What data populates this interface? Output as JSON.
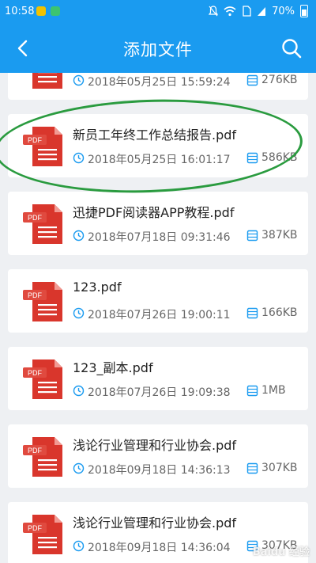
{
  "status_bar": {
    "time": "10:58",
    "battery_percent": "70%",
    "icons": [
      "notifications-off-icon",
      "wifi-icon",
      "sim-icon",
      "signal-icon",
      "battery-icon"
    ]
  },
  "toolbar": {
    "title": "添加文件",
    "back_icon": "chevron-left-icon",
    "search_icon": "search-icon"
  },
  "files": [
    {
      "name": "",
      "date": "2018年05月25日 15:59:24",
      "size": "276KB"
    },
    {
      "name": "新员工年终工作总结报告.pdf",
      "date": "2018年05月25日 16:01:17",
      "size": "586KB"
    },
    {
      "name": "迅捷PDF阅读器APP教程.pdf",
      "date": "2018年07月18日 09:31:46",
      "size": "387KB"
    },
    {
      "name": "123.pdf",
      "date": "2018年07月26日 19:00:11",
      "size": "166KB"
    },
    {
      "name": "123_副本.pdf",
      "date": "2018年07月26日 19:09:38",
      "size": "1MB"
    },
    {
      "name": "浅论行业管理和行业协会.pdf",
      "date": "2018年09月18日 14:36:13",
      "size": "307KB"
    },
    {
      "name": "浅论行业管理和行业协会.pdf",
      "date": "2018年09月18日 14:36:04",
      "size": "307KB"
    }
  ],
  "pdf_icon_label": "PDF",
  "watermark": "Baidu 经验",
  "colors": {
    "primary": "#1a9bf0",
    "pdf_red": "#d9362c",
    "annotation_green": "#2a9b3f"
  }
}
